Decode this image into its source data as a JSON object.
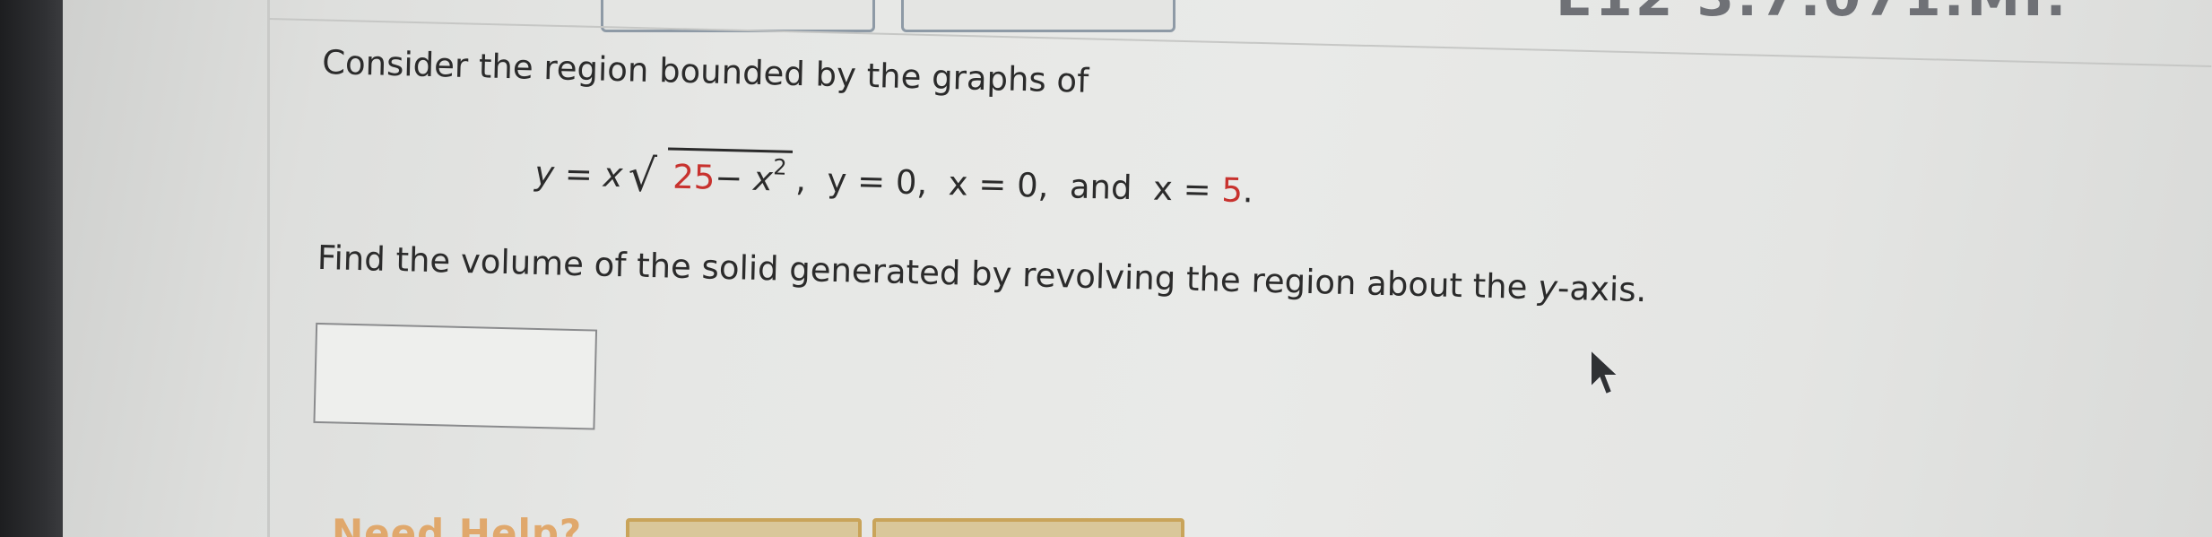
{
  "header": {
    "partial_text": "E12 3.7.071.MI."
  },
  "problem": {
    "intro": "Consider the region bounded by the graphs of",
    "equation": {
      "lhs": "y = x",
      "radicand_number": "25",
      "radicand_rest": " − x",
      "exponent": "2",
      "after": ",  y = 0,  x = 0,  and  x = ",
      "x_value": "5",
      "period": "."
    },
    "task_before": "Find the volume of the solid generated by revolving the region about the ",
    "task_var": "y",
    "task_after": "-axis."
  },
  "answer": {
    "value": ""
  },
  "footer": {
    "partial_text": "Need Help?"
  },
  "colors": {
    "highlight": "#c8322e",
    "text": "#2b2b2b"
  }
}
